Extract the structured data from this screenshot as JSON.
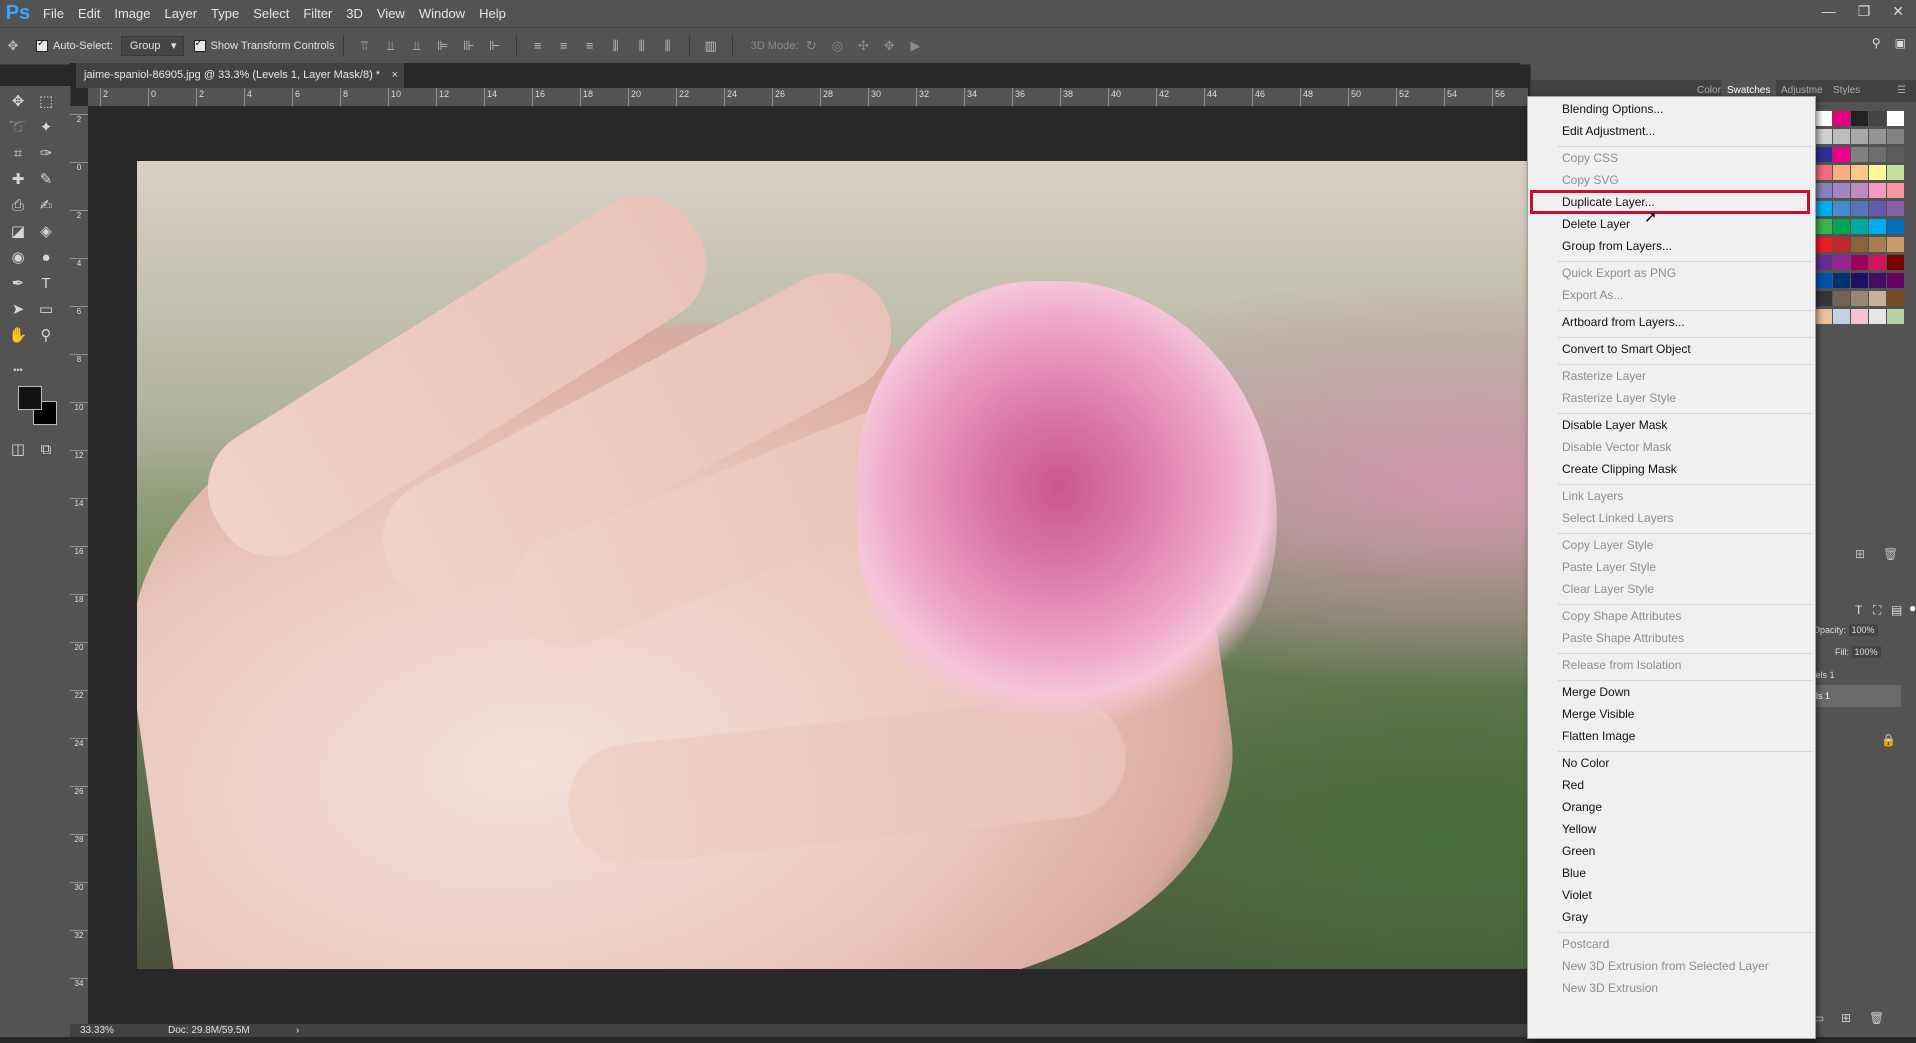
{
  "app": {
    "logo": "Ps"
  },
  "menubar": {
    "items": [
      "File",
      "Edit",
      "Image",
      "Layer",
      "Type",
      "Select",
      "Filter",
      "3D",
      "View",
      "Window",
      "Help"
    ],
    "window_controls": [
      "—",
      "❐",
      "✕"
    ]
  },
  "options_bar": {
    "auto_select_label": "Auto-Select:",
    "auto_select_value": "Group",
    "show_transform_label": "Show Transform Controls",
    "mode_3d_label": "3D Mode:"
  },
  "document": {
    "tab_title": "jaime-spaniol-86905.jpg @ 33.3% (Levels 1, Layer Mask/8) *",
    "close_glyph": "×"
  },
  "ruler": {
    "h_labels": [
      "2",
      "0",
      "2",
      "4",
      "6",
      "8",
      "10",
      "12",
      "14",
      "16",
      "18",
      "20",
      "22",
      "24",
      "26",
      "28",
      "30",
      "32",
      "34",
      "36",
      "38",
      "40",
      "42",
      "44",
      "46",
      "48",
      "50",
      "52",
      "54",
      "56"
    ],
    "v_labels": [
      "2",
      "0",
      "2",
      "4",
      "6",
      "8",
      "10",
      "12",
      "14",
      "16",
      "18",
      "20",
      "22",
      "24",
      "26",
      "28",
      "30",
      "32",
      "34"
    ]
  },
  "status": {
    "zoom": "33.33%",
    "doc_size": "Doc: 29.8M/59.5M",
    "arrow": "›"
  },
  "panels": {
    "tabs": [
      "Color",
      "Swatches",
      "Adjustme",
      "Styles"
    ],
    "active_tab": "Swatches",
    "opacity_label": "Opacity:",
    "opacity_value": "100%",
    "fill_label": "Fill:",
    "fill_value": "100%",
    "layer1": "vels 1",
    "layer2": "els 1"
  },
  "swatch_colors": [
    [
      "#ffffff",
      "#e6007e",
      "#222222",
      "#444444",
      "#ffffff"
    ],
    [
      "#d0d0d0",
      "#bdbdbd",
      "#a8a8a8",
      "#959595",
      "#828282"
    ],
    [
      "#2e3192",
      "#ec008c",
      "#808080",
      "#6e6e6e",
      "#5b5b5b"
    ],
    [
      "#f26d7d",
      "#f9ad81",
      "#fdc68a",
      "#fff799",
      "#c4df9b"
    ],
    [
      "#8781bd",
      "#a187be",
      "#bd8cbf",
      "#f49ac2",
      "#f6989d"
    ],
    [
      "#00aeef",
      "#448ccb",
      "#5674b9",
      "#605ca8",
      "#8560a8"
    ],
    [
      "#39b54a",
      "#00a651",
      "#00a99d",
      "#00aeef",
      "#0072bc"
    ],
    [
      "#ed1c24",
      "#c1272d",
      "#8c6239",
      "#a67c52",
      "#c69c6d"
    ],
    [
      "#662d91",
      "#92278f",
      "#9e005d",
      "#d4145a",
      "#790000"
    ],
    [
      "#0054a6",
      "#003471",
      "#1b1464",
      "#440e62",
      "#630460"
    ],
    [
      "#363636",
      "#736357",
      "#998675",
      "#c7b299",
      "#754c24"
    ],
    [
      "#e8c39e",
      "#c2d2e0",
      "#f2c4d0",
      "#e6e6e6",
      "#b5d3a5"
    ]
  ],
  "context_menu": {
    "highlighted": "Duplicate Layer...",
    "items": [
      {
        "label": "Blending Options...",
        "enabled": true
      },
      {
        "label": "Edit Adjustment...",
        "enabled": true
      },
      {
        "sep": true
      },
      {
        "label": "Copy CSS",
        "enabled": false
      },
      {
        "label": "Copy SVG",
        "enabled": false
      },
      {
        "label": "Duplicate Layer...",
        "enabled": true
      },
      {
        "label": "Delete Layer",
        "enabled": true
      },
      {
        "label": "Group from Layers...",
        "enabled": true
      },
      {
        "sep": true
      },
      {
        "label": "Quick Export as PNG",
        "enabled": false
      },
      {
        "label": "Export As...",
        "enabled": false
      },
      {
        "sep": true
      },
      {
        "label": "Artboard from Layers...",
        "enabled": true
      },
      {
        "sep": true
      },
      {
        "label": "Convert to Smart Object",
        "enabled": true
      },
      {
        "sep": true
      },
      {
        "label": "Rasterize Layer",
        "enabled": false
      },
      {
        "label": "Rasterize Layer Style",
        "enabled": false
      },
      {
        "sep": true
      },
      {
        "label": "Disable Layer Mask",
        "enabled": true
      },
      {
        "label": "Disable Vector Mask",
        "enabled": false
      },
      {
        "label": "Create Clipping Mask",
        "enabled": true
      },
      {
        "sep": true
      },
      {
        "label": "Link Layers",
        "enabled": false
      },
      {
        "label": "Select Linked Layers",
        "enabled": false
      },
      {
        "sep": true
      },
      {
        "label": "Copy Layer Style",
        "enabled": false
      },
      {
        "label": "Paste Layer Style",
        "enabled": false
      },
      {
        "label": "Clear Layer Style",
        "enabled": false
      },
      {
        "sep": true
      },
      {
        "label": "Copy Shape Attributes",
        "enabled": false
      },
      {
        "label": "Paste Shape Attributes",
        "enabled": false
      },
      {
        "sep": true
      },
      {
        "label": "Release from Isolation",
        "enabled": false
      },
      {
        "sep": true
      },
      {
        "label": "Merge Down",
        "enabled": true
      },
      {
        "label": "Merge Visible",
        "enabled": true
      },
      {
        "label": "Flatten Image",
        "enabled": true
      },
      {
        "sep": true
      },
      {
        "label": "No Color",
        "enabled": true
      },
      {
        "label": "Red",
        "enabled": true
      },
      {
        "label": "Orange",
        "enabled": true
      },
      {
        "label": "Yellow",
        "enabled": true
      },
      {
        "label": "Green",
        "enabled": true
      },
      {
        "label": "Blue",
        "enabled": true
      },
      {
        "label": "Violet",
        "enabled": true
      },
      {
        "label": "Gray",
        "enabled": true
      },
      {
        "sep": true
      },
      {
        "label": "Postcard",
        "enabled": false
      },
      {
        "label": "New 3D Extrusion from Selected Layer",
        "enabled": false
      },
      {
        "label": "New 3D Extrusion",
        "enabled": false
      }
    ]
  },
  "tools": [
    "move-tool-icon",
    "marquee-tool-icon",
    "lasso-tool-icon",
    "magic-wand-tool-icon",
    "crop-tool-icon",
    "eyedropper-tool-icon",
    "healing-brush-tool-icon",
    "brush-tool-icon",
    "clone-stamp-tool-icon",
    "history-brush-tool-icon",
    "eraser-tool-icon",
    "paint-bucket-tool-icon",
    "blur-tool-icon",
    "dodge-tool-icon",
    "pen-tool-icon",
    "type-tool-icon",
    "path-selection-tool-icon",
    "rectangle-tool-icon",
    "hand-tool-icon",
    "zoom-tool-icon"
  ],
  "tool_glyphs": [
    "✥",
    "⬚",
    "➰",
    "✦",
    "⌗",
    "✑",
    "✚",
    "✎",
    "⎙",
    "✍",
    "◪",
    "◈",
    "◉",
    "●",
    "✒",
    "T",
    "➤",
    "▭",
    "✋",
    "⚲"
  ],
  "more_tools": "•••"
}
